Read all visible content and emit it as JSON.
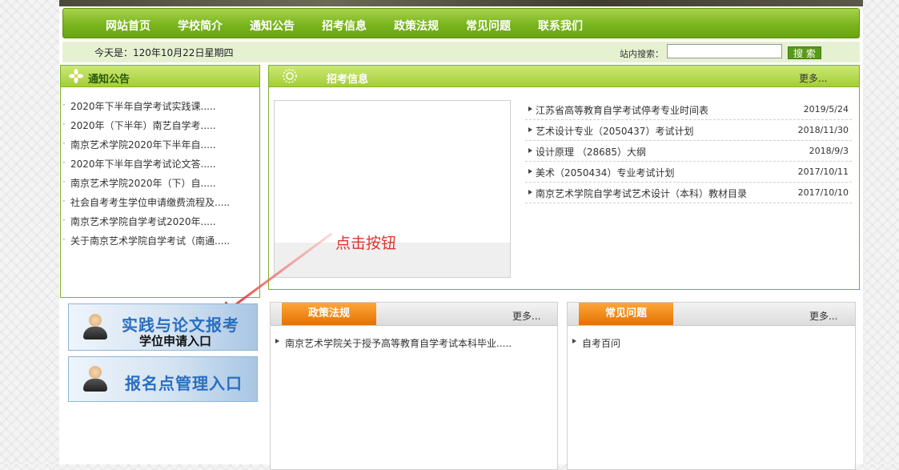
{
  "nav": {
    "items": [
      "网站首页",
      "学校简介",
      "通知公告",
      "招考信息",
      "政策法规",
      "常见问题",
      "联系我们"
    ]
  },
  "date_label": "今天是：120年10月22日星期四",
  "search": {
    "label": "站内搜索：",
    "value": "",
    "button": "搜 索"
  },
  "notice": {
    "title": "通知公告",
    "items": [
      "2020年下半年自学考试实践课.....",
      "2020年（下半年）南艺自学考.....",
      "南京艺术学院2020年下半年自.....",
      "2020年下半年自学考试论文答.....",
      "南京艺术学院2020年（下）自.....",
      "社会自考考生学位申请缴费流程及.....",
      "南京艺术学院自学考试2020年.....",
      "关于南京艺术学院自学考试（南通....."
    ]
  },
  "recruit": {
    "title": "招考信息",
    "more": "更多...",
    "items": [
      {
        "title": "江苏省高等教育自学考试停考专业时间表",
        "date": "2019/5/24"
      },
      {
        "title": "艺术设计专业（2050437）考试计划",
        "date": "2018/11/30"
      },
      {
        "title": "设计原理 （28685）大纲",
        "date": "2018/9/3"
      },
      {
        "title": "美术（2050434）专业考试计划",
        "date": "2017/10/11"
      },
      {
        "title": "南京艺术学院自学考试艺术设计（本科）教材目录",
        "date": "2017/10/10"
      }
    ]
  },
  "annotation": "点击按钮",
  "entries": {
    "practice": {
      "line1": "实践与论文报考",
      "line2": "学位申请入口"
    },
    "signup": {
      "line1": "报名点管理入口"
    }
  },
  "policy": {
    "title": "政策法规",
    "more": "更多...",
    "items": [
      "南京艺术学院关于授予高等教育自学考试本科毕业....."
    ]
  },
  "faq": {
    "title": "常见问题",
    "more": "更多...",
    "items": [
      "自考百问"
    ]
  },
  "colors": {
    "nav_green": "#79b51e",
    "tab_orange": "#f28c13",
    "entry_blue": "#2a6fc0",
    "annotation_red": "#e0332c"
  }
}
